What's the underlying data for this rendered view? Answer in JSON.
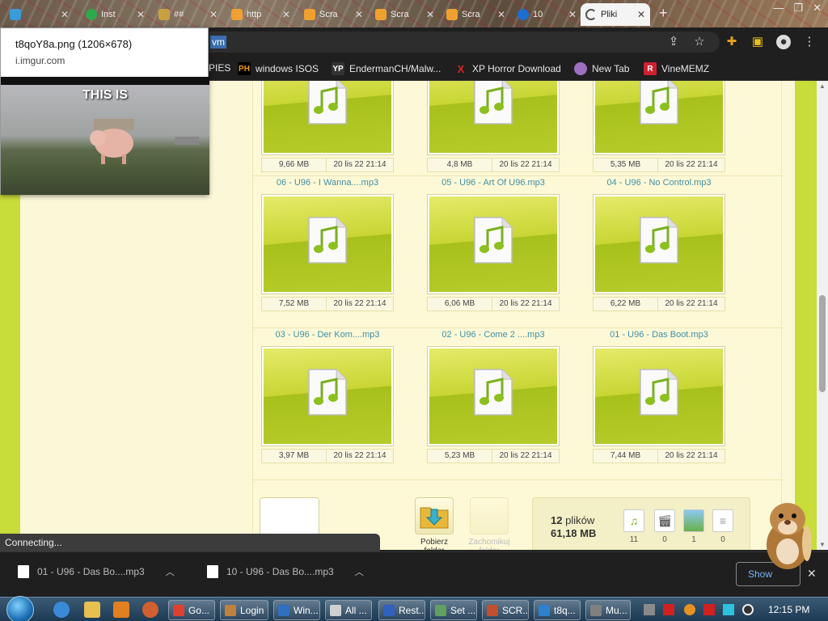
{
  "tabs": [
    {
      "label": "",
      "color": "#3a9bd8"
    },
    {
      "label": "Inst",
      "color": "#2ea84a"
    },
    {
      "label": "##",
      "color": "#c8a040"
    },
    {
      "label": "http",
      "color": "#f0a030"
    },
    {
      "label": "Scra",
      "color": "#f0a030"
    },
    {
      "label": "Scra",
      "color": "#f0a030"
    },
    {
      "label": "Scra",
      "color": "#f0a030"
    },
    {
      "label": "10",
      "color": "#1a6fd0"
    },
    {
      "label": "Pliki",
      "color": "#555555"
    }
  ],
  "omnibox": {
    "selected": "vm"
  },
  "bookmarks": [
    {
      "label": "PIES",
      "icon_text": "",
      "color": "#1f1f1f"
    },
    {
      "label": "windows ISOS",
      "icon_text": "PH",
      "color": "#f29a00"
    },
    {
      "label": "EndermanCH/Malw...",
      "icon_text": "YP",
      "color": "#333333"
    },
    {
      "label": "XP Horror Download",
      "icon_text": "X",
      "color": "#d02020"
    },
    {
      "label": "New Tab",
      "icon_text": "",
      "color": "#a070c0"
    },
    {
      "label": "VineMEMZ",
      "icon_text": "R",
      "color": "#d02030"
    }
  ],
  "preview": {
    "title": "t8qoY8a.png (1206×678)",
    "url": "i.imgur.com",
    "caption": "THIS IS"
  },
  "files": [
    {
      "name": "",
      "size": "9,66 MB",
      "date": "20 lis 22 21:14"
    },
    {
      "name": "",
      "size": "4,8 MB",
      "date": "20 lis 22 21:14"
    },
    {
      "name": "",
      "size": "5,35 MB",
      "date": "20 lis 22 21:14"
    },
    {
      "name": "06 - U96 - I Wanna....mp3",
      "size": "7,52 MB",
      "date": "20 lis 22 21:14"
    },
    {
      "name": "05 - U96 - Art Of U96.mp3",
      "size": "6,06 MB",
      "date": "20 lis 22 21:14"
    },
    {
      "name": "04 - U96 - No Control.mp3",
      "size": "6,22 MB",
      "date": "20 lis 22 21:14"
    },
    {
      "name": "03 - U96 - Der Kom....mp3",
      "size": "3,97 MB",
      "date": "20 lis 22 21:14"
    },
    {
      "name": "02 - U96 - Come 2 ....mp3",
      "size": "5,23 MB",
      "date": "20 lis 22 21:14"
    },
    {
      "name": "01 - U96 - Das Boot.mp3",
      "size": "7,44 MB",
      "date": "20 lis 22 21:14"
    }
  ],
  "actions": {
    "download_folder": "Pobierz folder",
    "save_folder": "Zachomikuj folder"
  },
  "stats": {
    "count_num": "12",
    "count_word": "plików",
    "total": "61,18 MB",
    "audio": "11",
    "video": "0",
    "images": "1",
    "docs": "0"
  },
  "status": "Connecting...",
  "downloads": [
    {
      "label": "01 - U96 - Das Bo....mp3"
    },
    {
      "label": "10 - U96 - Das Bo....mp3"
    }
  ],
  "show_all": "Show",
  "taskbar": [
    {
      "label": "Go...",
      "color": "#e04030"
    },
    {
      "label": "Login",
      "color": "#c08040"
    },
    {
      "label": "Win...",
      "color": "#3070c0"
    },
    {
      "label": "All ...",
      "color": "#d0d0d0"
    },
    {
      "label": "Rest...",
      "color": "#3060c0"
    },
    {
      "label": "Set ...",
      "color": "#60a060"
    },
    {
      "label": "SCR...",
      "color": "#c05030"
    },
    {
      "label": "t8q...",
      "color": "#3080d0"
    },
    {
      "label": "Mu...",
      "color": "#808080"
    }
  ],
  "clock": "12:15 PM"
}
